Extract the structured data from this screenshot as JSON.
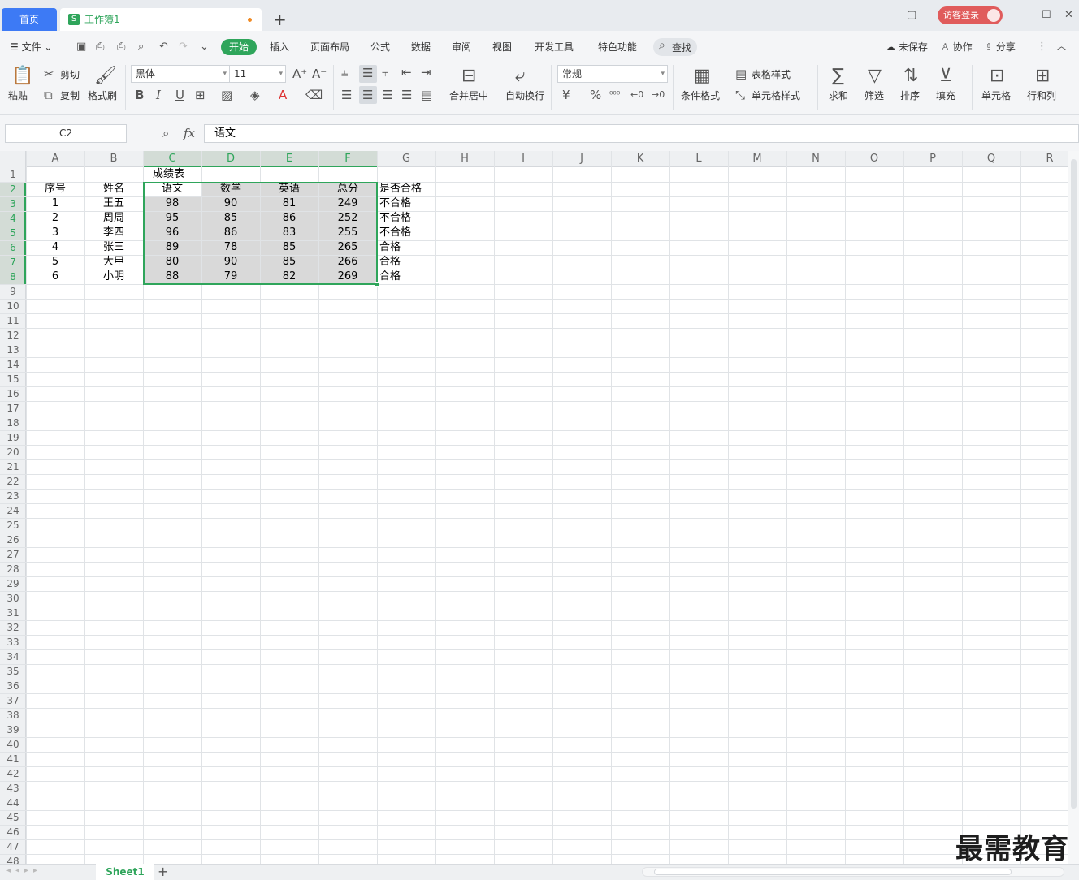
{
  "titlebar": {
    "home_tab": "首页",
    "workbook_tab": "工作簿1",
    "workbook_logo": "S",
    "new_tab": "+",
    "guest_login": "访客登录"
  },
  "menubar": {
    "file": "文件",
    "tabs": [
      "开始",
      "插入",
      "页面布局",
      "公式",
      "数据",
      "审阅",
      "视图",
      "开发工具",
      "特色功能"
    ],
    "search": "查找",
    "unsaved": "未保存",
    "collab": "协作",
    "share": "分享"
  },
  "ribbon": {
    "paste": "粘贴",
    "cut": "剪切",
    "copy": "复制",
    "format_painter": "格式刷",
    "font_name": "黑体",
    "font_size": "11",
    "merge_center": "合并居中",
    "auto_wrap": "自动换行",
    "number_format": "常规",
    "conditional_format": "条件格式",
    "table_style": "表格样式",
    "cell_style": "单元格样式",
    "sum": "求和",
    "filter": "筛选",
    "sort": "排序",
    "fill": "填充",
    "cell": "单元格",
    "row_col": "行和列",
    "bold": "B",
    "italic": "I",
    "underline": "U",
    "currency": "¥",
    "percent": "%"
  },
  "formula_bar": {
    "name_box": "C2",
    "fx": "fx",
    "content": "语文"
  },
  "sheet": {
    "columns": [
      "A",
      "B",
      "C",
      "D",
      "E",
      "F",
      "G",
      "H",
      "I",
      "J",
      "K",
      "L",
      "M",
      "N",
      "O",
      "P",
      "Q",
      "R"
    ],
    "row_count": 48,
    "title": "成绩表",
    "headers": [
      "序号",
      "姓名",
      "语文",
      "数学",
      "英语",
      "总分",
      "是否合格"
    ],
    "rows": [
      [
        "1",
        "王五",
        "98",
        "90",
        "81",
        "249",
        "不合格"
      ],
      [
        "2",
        "周周",
        "95",
        "85",
        "86",
        "252",
        "不合格"
      ],
      [
        "3",
        "李四",
        "96",
        "86",
        "83",
        "255",
        "不合格"
      ],
      [
        "4",
        "张三",
        "89",
        "78",
        "85",
        "265",
        "合格"
      ],
      [
        "5",
        "大甲",
        "80",
        "90",
        "85",
        "266",
        "合格"
      ],
      [
        "6",
        "小明",
        "88",
        "79",
        "82",
        "269",
        "合格"
      ]
    ]
  },
  "sheet_tabs": {
    "active": "Sheet1",
    "add": "+"
  },
  "watermark": "最需教育",
  "colors": {
    "accent_green": "#2fa55b",
    "home_blue": "#3d7af5",
    "guest_red": "#e05b5b",
    "selection_fill": "#d9d9d9"
  }
}
